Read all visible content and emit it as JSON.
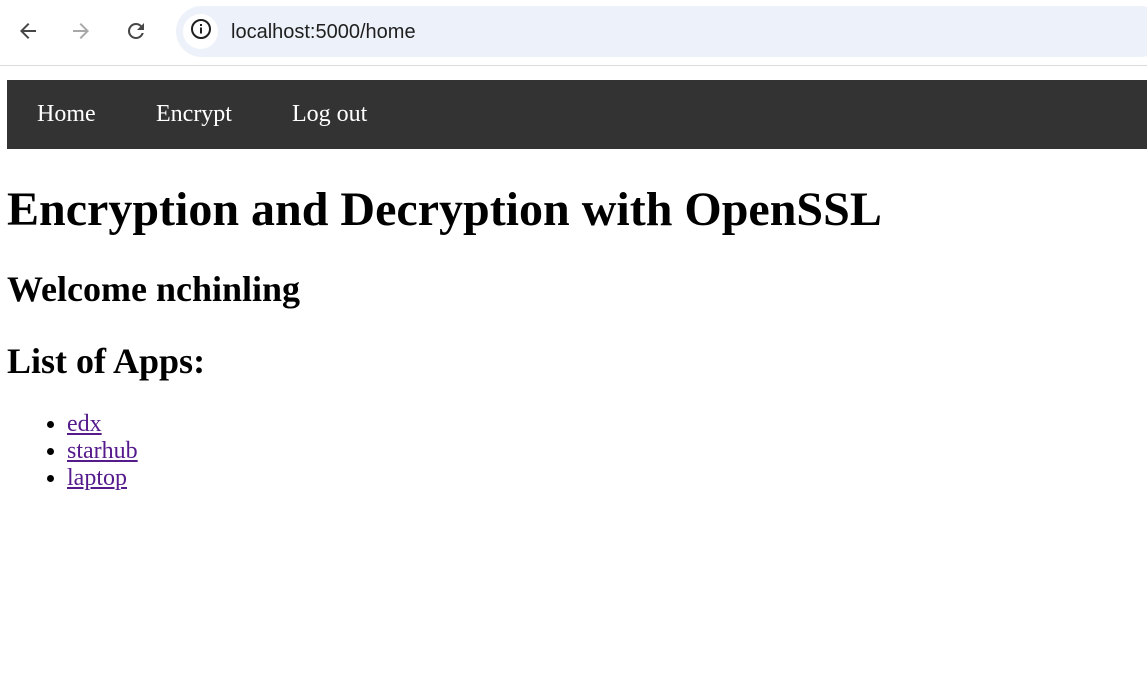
{
  "browser": {
    "url": "localhost:5000/home",
    "icons": {
      "back": "back-arrow-icon",
      "forward": "forward-arrow-icon",
      "reload": "reload-icon",
      "site_info": "info-icon"
    }
  },
  "nav": {
    "items": [
      {
        "label": "Home"
      },
      {
        "label": "Encrypt"
      },
      {
        "label": "Log out"
      }
    ],
    "background": "#333333",
    "text_color": "#ffffff"
  },
  "main": {
    "title": "Encryption and Decryption with OpenSSL",
    "welcome": "Welcome nchinling",
    "list_heading": "List of Apps:",
    "apps": [
      {
        "label": "edx"
      },
      {
        "label": "starhub"
      },
      {
        "label": "laptop"
      }
    ],
    "link_color": "#551a8b"
  }
}
